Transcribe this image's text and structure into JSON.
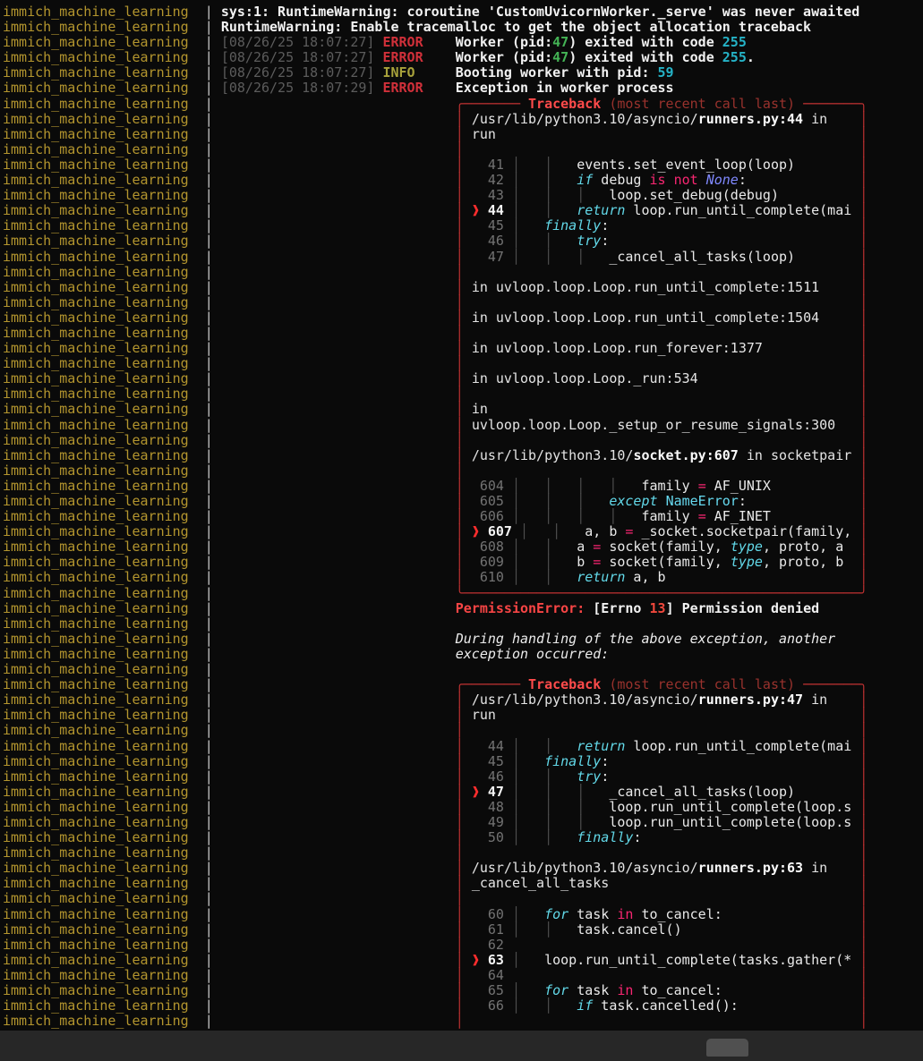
{
  "terminal": {
    "service_name": "immich_machine_learning",
    "separator": "|",
    "box_inner_width": 47,
    "colors": {
      "background": "#0a0a0a",
      "service_name": "#b3952e",
      "error_level": "#d1303a",
      "info_level": "#a8a23b",
      "traceback_border": "#c03232",
      "pid_number_green": "#44b455",
      "number_cyan": "#25b3c7",
      "keyword_cyan": "#62d8e8",
      "operator_pink": "#f92672"
    },
    "lines": [
      {
        "s": [
          [
            "b",
            "sys:1: RuntimeWarning: coroutine 'CustomUvicornWorker._serve' was never awaited"
          ]
        ]
      },
      {
        "s": [
          [
            "b",
            "RuntimeWarning: Enable tracemalloc to get the object allocation traceback"
          ]
        ]
      },
      {
        "s": [
          [
            "ts",
            "[08/26/25 18:07:27]"
          ],
          [
            "code",
            " "
          ],
          [
            "err",
            "ERROR"
          ],
          [
            "code",
            "    "
          ],
          [
            "msgb",
            "Worker (pid:"
          ],
          [
            "grn",
            "47"
          ],
          [
            "msgb",
            ") exited with code "
          ],
          [
            "cyn",
            "255"
          ]
        ]
      },
      {
        "s": [
          [
            "ts",
            "[08/26/25 18:07:27]"
          ],
          [
            "code",
            " "
          ],
          [
            "err",
            "ERROR"
          ],
          [
            "code",
            "    "
          ],
          [
            "msgb",
            "Worker (pid:"
          ],
          [
            "grn",
            "47"
          ],
          [
            "msgb",
            ") exited with code "
          ],
          [
            "cyn",
            "255"
          ],
          [
            "msgb",
            "."
          ]
        ]
      },
      {
        "s": [
          [
            "ts",
            "[08/26/25 18:07:27]"
          ],
          [
            "code",
            " "
          ],
          [
            "info",
            "INFO"
          ],
          [
            "code",
            "     "
          ],
          [
            "msgb",
            "Booting worker with pid: "
          ],
          [
            "cyn",
            "59"
          ]
        ]
      },
      {
        "s": [
          [
            "ts",
            "[08/26/25 18:07:29]"
          ],
          [
            "code",
            " "
          ],
          [
            "err",
            "ERROR"
          ],
          [
            "code",
            "    "
          ],
          [
            "msgb",
            "Exception in worker process"
          ]
        ]
      },
      {
        "i": 29,
        "s": [
          [
            "bdr",
            "╭─────── "
          ],
          [
            "tbt",
            "Traceback "
          ],
          [
            "tbs",
            "(most recent call last)"
          ],
          [
            "bdr",
            " ───────╮"
          ]
        ]
      },
      {
        "i": 29,
        "box": true,
        "s": [
          [
            "path",
            "/usr/lib/python3.10/asyncio/"
          ],
          [
            "file",
            "runners.py:44"
          ],
          [
            "path",
            " in"
          ]
        ]
      },
      {
        "i": 29,
        "box": true,
        "s": [
          [
            "path",
            "run"
          ]
        ]
      },
      {
        "i": 29,
        "box": true,
        "s": []
      },
      {
        "i": 29,
        "box": true,
        "s": [
          [
            "gut",
            "  41 "
          ],
          [
            "gd",
            "│   │   "
          ],
          [
            "code",
            "events.set_event_loop(loop)"
          ]
        ]
      },
      {
        "i": 29,
        "box": true,
        "s": [
          [
            "gut",
            "  42 "
          ],
          [
            "gd",
            "│   │   "
          ],
          [
            "kw",
            "if"
          ],
          [
            "code",
            " debug "
          ],
          [
            "opw",
            "is not"
          ],
          [
            "code",
            " "
          ],
          [
            "kc",
            "None"
          ],
          [
            "code",
            ":"
          ]
        ]
      },
      {
        "i": 29,
        "box": true,
        "s": [
          [
            "gut",
            "  43 "
          ],
          [
            "gd",
            "│   │   │   "
          ],
          [
            "code",
            "loop.set_debug(debug)"
          ]
        ]
      },
      {
        "i": 29,
        "box": true,
        "s": [
          [
            "arrow",
            "❱ "
          ],
          [
            "ghl",
            "44 "
          ],
          [
            "gd",
            "│   │   "
          ],
          [
            "kw",
            "return"
          ],
          [
            "code",
            " loop.run_until_complete(mai"
          ]
        ]
      },
      {
        "i": 29,
        "box": true,
        "s": [
          [
            "gut",
            "  45 "
          ],
          [
            "gd",
            "│   "
          ],
          [
            "kw",
            "finally"
          ],
          [
            "code",
            ":"
          ]
        ]
      },
      {
        "i": 29,
        "box": true,
        "s": [
          [
            "gut",
            "  46 "
          ],
          [
            "gd",
            "│   │   "
          ],
          [
            "kw",
            "try"
          ],
          [
            "code",
            ":"
          ]
        ]
      },
      {
        "i": 29,
        "box": true,
        "s": [
          [
            "gut",
            "  47 "
          ],
          [
            "gd",
            "│   │   │   "
          ],
          [
            "code",
            "_cancel_all_tasks(loop)"
          ]
        ]
      },
      {
        "i": 29,
        "box": true,
        "s": []
      },
      {
        "i": 29,
        "box": true,
        "s": [
          [
            "path",
            "in uvloop.loop.Loop.run_until_complete:1511"
          ]
        ]
      },
      {
        "i": 29,
        "box": true,
        "s": []
      },
      {
        "i": 29,
        "box": true,
        "s": [
          [
            "path",
            "in uvloop.loop.Loop.run_until_complete:1504"
          ]
        ]
      },
      {
        "i": 29,
        "box": true,
        "s": []
      },
      {
        "i": 29,
        "box": true,
        "s": [
          [
            "path",
            "in uvloop.loop.Loop.run_forever:1377"
          ]
        ]
      },
      {
        "i": 29,
        "box": true,
        "s": []
      },
      {
        "i": 29,
        "box": true,
        "s": [
          [
            "path",
            "in uvloop.loop.Loop._run:534"
          ]
        ]
      },
      {
        "i": 29,
        "box": true,
        "s": []
      },
      {
        "i": 29,
        "box": true,
        "s": [
          [
            "path",
            "in"
          ]
        ]
      },
      {
        "i": 29,
        "box": true,
        "s": [
          [
            "path",
            "uvloop.loop.Loop._setup_or_resume_signals:300"
          ]
        ]
      },
      {
        "i": 29,
        "box": true,
        "s": []
      },
      {
        "i": 29,
        "box": true,
        "s": [
          [
            "path",
            "/usr/lib/python3.10/"
          ],
          [
            "file",
            "socket.py:607"
          ],
          [
            "path",
            " in socketpair"
          ]
        ]
      },
      {
        "i": 29,
        "box": true,
        "s": []
      },
      {
        "i": 29,
        "box": true,
        "s": [
          [
            "gut",
            " 604 "
          ],
          [
            "gd",
            "│   │   │   │   "
          ],
          [
            "code",
            "family "
          ],
          [
            "opw",
            "="
          ],
          [
            "code",
            " AF_UNIX"
          ]
        ]
      },
      {
        "i": 29,
        "box": true,
        "s": [
          [
            "gut",
            " 605 "
          ],
          [
            "gd",
            "│   │   │   "
          ],
          [
            "kw",
            "except"
          ],
          [
            "code",
            " "
          ],
          [
            "exc",
            "NameError"
          ],
          [
            "code",
            ":"
          ]
        ]
      },
      {
        "i": 29,
        "box": true,
        "s": [
          [
            "gut",
            " 606 "
          ],
          [
            "gd",
            "│   │   │   │   "
          ],
          [
            "code",
            "family "
          ],
          [
            "opw",
            "="
          ],
          [
            "code",
            " AF_INET"
          ]
        ]
      },
      {
        "i": 29,
        "box": true,
        "s": [
          [
            "arrow",
            "❱ "
          ],
          [
            "ghl",
            "607"
          ],
          [
            "code",
            " "
          ],
          [
            "gd",
            "│   │   "
          ],
          [
            "code",
            "a, b "
          ],
          [
            "opw",
            "="
          ],
          [
            "code",
            " _socket.socketpair(family,"
          ]
        ]
      },
      {
        "i": 29,
        "box": true,
        "s": [
          [
            "gut",
            " 608 "
          ],
          [
            "gd",
            "│   │   "
          ],
          [
            "code",
            "a "
          ],
          [
            "opw",
            "="
          ],
          [
            "code",
            " socket(family, "
          ],
          [
            "bi",
            "type"
          ],
          [
            "code",
            ", proto, a"
          ]
        ]
      },
      {
        "i": 29,
        "box": true,
        "s": [
          [
            "gut",
            " 609 "
          ],
          [
            "gd",
            "│   │   "
          ],
          [
            "code",
            "b "
          ],
          [
            "opw",
            "="
          ],
          [
            "code",
            " socket(family, "
          ],
          [
            "bi",
            "type"
          ],
          [
            "code",
            ", proto, b"
          ]
        ]
      },
      {
        "i": 29,
        "box": true,
        "s": [
          [
            "gut",
            " 610 "
          ],
          [
            "gd",
            "│   │   "
          ],
          [
            "kw",
            "return"
          ],
          [
            "code",
            " a, b"
          ]
        ]
      },
      {
        "i": 29,
        "s": [
          [
            "bdr",
            "╰─────────────────────────────────────────────────╯"
          ]
        ]
      },
      {
        "i": 29,
        "s": [
          [
            "exct",
            "PermissionError: "
          ],
          [
            "msgb",
            "[Errno "
          ],
          [
            "errno",
            "13"
          ],
          [
            "msgb",
            "] Permission denied"
          ]
        ]
      },
      {
        "s": []
      },
      {
        "i": 29,
        "s": [
          [
            "ital",
            "During handling of the above exception, another"
          ]
        ]
      },
      {
        "i": 29,
        "s": [
          [
            "ital",
            "exception occurred:"
          ]
        ]
      },
      {
        "s": []
      },
      {
        "i": 29,
        "s": [
          [
            "bdr",
            "╭─────── "
          ],
          [
            "tbt",
            "Traceback "
          ],
          [
            "tbs",
            "(most recent call last)"
          ],
          [
            "bdr",
            " ───────╮"
          ]
        ]
      },
      {
        "i": 29,
        "box": true,
        "s": [
          [
            "path",
            "/usr/lib/python3.10/asyncio/"
          ],
          [
            "file",
            "runners.py:47"
          ],
          [
            "path",
            " in"
          ]
        ]
      },
      {
        "i": 29,
        "box": true,
        "s": [
          [
            "path",
            "run"
          ]
        ]
      },
      {
        "i": 29,
        "box": true,
        "s": []
      },
      {
        "i": 29,
        "box": true,
        "s": [
          [
            "gut",
            "  44 "
          ],
          [
            "gd",
            "│   │   "
          ],
          [
            "kw",
            "return"
          ],
          [
            "code",
            " loop.run_until_complete(mai"
          ]
        ]
      },
      {
        "i": 29,
        "box": true,
        "s": [
          [
            "gut",
            "  45 "
          ],
          [
            "gd",
            "│   "
          ],
          [
            "kw",
            "finally"
          ],
          [
            "code",
            ":"
          ]
        ]
      },
      {
        "i": 29,
        "box": true,
        "s": [
          [
            "gut",
            "  46 "
          ],
          [
            "gd",
            "│   │   "
          ],
          [
            "kw",
            "try"
          ],
          [
            "code",
            ":"
          ]
        ]
      },
      {
        "i": 29,
        "box": true,
        "s": [
          [
            "arrow",
            "❱ "
          ],
          [
            "ghl",
            "47 "
          ],
          [
            "gd",
            "│   │   │   "
          ],
          [
            "code",
            "_cancel_all_tasks(loop)"
          ]
        ]
      },
      {
        "i": 29,
        "box": true,
        "s": [
          [
            "gut",
            "  48 "
          ],
          [
            "gd",
            "│   │   │   "
          ],
          [
            "code",
            "loop.run_until_complete(loop.s"
          ]
        ]
      },
      {
        "i": 29,
        "box": true,
        "s": [
          [
            "gut",
            "  49 "
          ],
          [
            "gd",
            "│   │   │   "
          ],
          [
            "code",
            "loop.run_until_complete(loop.s"
          ]
        ]
      },
      {
        "i": 29,
        "box": true,
        "s": [
          [
            "gut",
            "  50 "
          ],
          [
            "gd",
            "│   │   "
          ],
          [
            "kw",
            "finally"
          ],
          [
            "code",
            ":"
          ]
        ]
      },
      {
        "i": 29,
        "box": true,
        "s": []
      },
      {
        "i": 29,
        "box": true,
        "s": [
          [
            "path",
            "/usr/lib/python3.10/asyncio/"
          ],
          [
            "file",
            "runners.py:63"
          ],
          [
            "path",
            " in"
          ]
        ]
      },
      {
        "i": 29,
        "box": true,
        "s": [
          [
            "path",
            "_cancel_all_tasks"
          ]
        ]
      },
      {
        "i": 29,
        "box": true,
        "s": []
      },
      {
        "i": 29,
        "box": true,
        "s": [
          [
            "gut",
            "  60 "
          ],
          [
            "gd",
            "│   "
          ],
          [
            "kw",
            "for"
          ],
          [
            "code",
            " task "
          ],
          [
            "opw",
            "in"
          ],
          [
            "code",
            " to_cancel:"
          ]
        ]
      },
      {
        "i": 29,
        "box": true,
        "s": [
          [
            "gut",
            "  61 "
          ],
          [
            "gd",
            "│   │   "
          ],
          [
            "code",
            "task.cancel()"
          ]
        ]
      },
      {
        "i": 29,
        "box": true,
        "s": [
          [
            "gut",
            "  62 "
          ]
        ]
      },
      {
        "i": 29,
        "box": true,
        "s": [
          [
            "arrow",
            "❱ "
          ],
          [
            "ghl",
            "63 "
          ],
          [
            "gd",
            "│   "
          ],
          [
            "code",
            "loop.run_until_complete(tasks.gather(*"
          ]
        ]
      },
      {
        "i": 29,
        "box": true,
        "s": [
          [
            "gut",
            "  64 "
          ]
        ]
      },
      {
        "i": 29,
        "box": true,
        "s": [
          [
            "gut",
            "  65 "
          ],
          [
            "gd",
            "│   "
          ],
          [
            "kw",
            "for"
          ],
          [
            "code",
            " task "
          ],
          [
            "opw",
            "in"
          ],
          [
            "code",
            " to_cancel:"
          ]
        ]
      },
      {
        "i": 29,
        "box": true,
        "s": [
          [
            "gut",
            "  66 "
          ],
          [
            "gd",
            "│   │   "
          ],
          [
            "kw",
            "if"
          ],
          [
            "code",
            " task.cancelled():"
          ]
        ]
      },
      {
        "i": 29,
        "box": true,
        "s": []
      }
    ]
  },
  "scrollbar": {
    "present": true
  }
}
